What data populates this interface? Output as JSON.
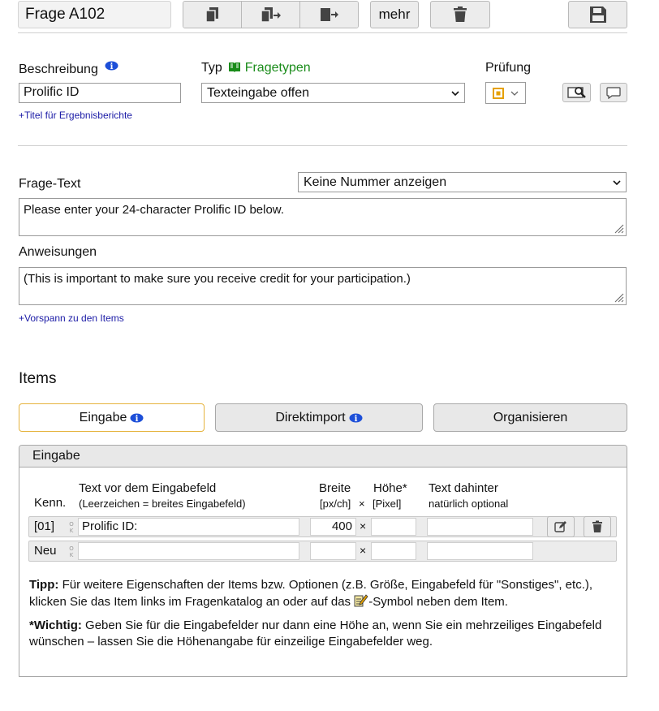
{
  "header": {
    "title": "Frage A102",
    "more_label": "mehr"
  },
  "question": {
    "description_label": "Beschreibung",
    "description_value": "Prolific ID",
    "type_label": "Typ",
    "type_link": "Fragetypen",
    "type_value": "Texteingabe offen",
    "check_label": "Prüfung",
    "results_title_link": "+Titel für Ergebnisberichte",
    "text_label": "Frage-Text",
    "numbering_value": "Keine Nummer anzeigen",
    "text_value": "Please enter your 24-character Prolific ID below.",
    "instructions_label": "Anweisungen",
    "instructions_value": "(This is important to make sure you receive credit for your participation.)",
    "preface_link": "+Vorspann zu den Items"
  },
  "items": {
    "heading": "Items",
    "tabs": [
      {
        "label": "Eingabe",
        "active": true
      },
      {
        "label": "Direktimport",
        "active": false
      },
      {
        "label": "Organisieren",
        "active": false
      }
    ],
    "panel_title": "Eingabe",
    "columns": {
      "kenn": "Kenn.",
      "text_before": "Text vor dem Eingabefeld",
      "text_before_sub": "(Leerzeichen = breites Eingabefeld)",
      "width": "Breite",
      "width_sub": "[px/ch]",
      "times": "×",
      "height": "Höhe*",
      "height_sub": "[Pixel]",
      "text_after": "Text dahinter",
      "text_after_sub": "natürlich optional"
    },
    "rows": [
      {
        "kenn": "[01]",
        "text_before": "Prolific ID:",
        "width": "400",
        "times": "×",
        "height": "",
        "text_after": ""
      },
      {
        "kenn": "Neu",
        "text_before": "",
        "width": "",
        "times": "×",
        "height": "",
        "text_after": ""
      }
    ],
    "tip_label": "Tipp:",
    "tip_text_1": "Für weitere Eigenschaften der Items bzw. Optionen (z.B. Größe, Eingabefeld für \"Sonstiges\", etc.), klicken Sie das Item links im Fragenkatalog an oder auf das",
    "tip_text_2": "-Symbol neben dem Item.",
    "important_label": "*Wichtig:",
    "important_text": "Geben Sie für die Eingabefelder nur dann eine Höhe an, wenn Sie ein mehrzeiliges Eingabefeld wünschen – lassen Sie die Höhenangabe für einzeilige Eingabefelder weg."
  },
  "colors": {
    "accent_orange": "#e5a000",
    "link_blue": "#1a1aa6",
    "link_green": "#1a8c1a",
    "info_blue": "#1d4fd8"
  },
  "icons": [
    "copy-icon",
    "copy-move-icon",
    "move-icon",
    "trash-icon",
    "save-icon",
    "info-icon",
    "book-icon",
    "check-style-icon",
    "chevron-down-icon",
    "preview-search-icon",
    "comment-icon",
    "resize-grip-icon",
    "ok-mark-icon",
    "edit-icon",
    "pencil-list-icon"
  ]
}
